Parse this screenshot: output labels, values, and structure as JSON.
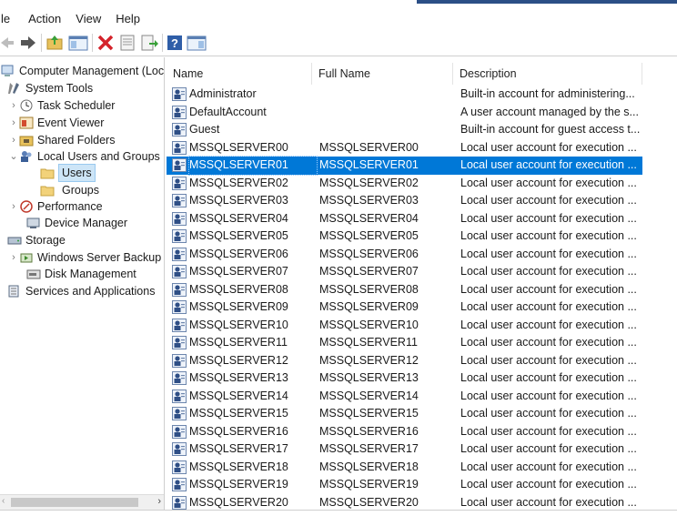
{
  "menu": {
    "items": [
      "le",
      "Action",
      "View",
      "Help"
    ]
  },
  "toolbar": {
    "buttons": [
      "back-arrow-icon",
      "forward-arrow-icon",
      "up-folder-icon",
      "show-hide-tree-icon",
      "delete-icon",
      "properties-icon",
      "export-list-icon",
      "help-icon",
      "action-pane-icon"
    ]
  },
  "tree": {
    "items": [
      {
        "label": "Computer Management (Local",
        "icon": "computer-management-icon"
      },
      {
        "label": "System Tools",
        "icon": "system-tools-icon"
      },
      {
        "label": "Task Scheduler",
        "icon": "task-scheduler-icon"
      },
      {
        "label": "Event Viewer",
        "icon": "event-viewer-icon"
      },
      {
        "label": "Shared Folders",
        "icon": "shared-folders-icon"
      },
      {
        "label": "Local Users and Groups",
        "icon": "local-users-icon"
      },
      {
        "label": "Users",
        "icon": "folder-icon"
      },
      {
        "label": "Groups",
        "icon": "folder-icon"
      },
      {
        "label": "Performance",
        "icon": "performance-icon"
      },
      {
        "label": "Device Manager",
        "icon": "device-manager-icon"
      },
      {
        "label": "Storage",
        "icon": "storage-icon"
      },
      {
        "label": "Windows Server Backup",
        "icon": "backup-icon"
      },
      {
        "label": "Disk Management",
        "icon": "disk-management-icon"
      },
      {
        "label": "Services and Applications",
        "icon": "services-icon"
      }
    ]
  },
  "table": {
    "columns": [
      "Name",
      "Full Name",
      "Description"
    ],
    "rows": [
      {
        "name": "Administrator",
        "full": "",
        "desc": "Built-in account for administering..."
      },
      {
        "name": "DefaultAccount",
        "full": "",
        "desc": "A user account managed by the s..."
      },
      {
        "name": "Guest",
        "full": "",
        "desc": "Built-in account for guest access t..."
      },
      {
        "name": "MSSQLSERVER00",
        "full": "MSSQLSERVER00",
        "desc": "Local user account for execution ..."
      },
      {
        "name": "MSSQLSERVER01",
        "full": "MSSQLSERVER01",
        "desc": "Local user account for execution ..."
      },
      {
        "name": "MSSQLSERVER02",
        "full": "MSSQLSERVER02",
        "desc": "Local user account for execution ..."
      },
      {
        "name": "MSSQLSERVER03",
        "full": "MSSQLSERVER03",
        "desc": "Local user account for execution ..."
      },
      {
        "name": "MSSQLSERVER04",
        "full": "MSSQLSERVER04",
        "desc": "Local user account for execution ..."
      },
      {
        "name": "MSSQLSERVER05",
        "full": "MSSQLSERVER05",
        "desc": "Local user account for execution ..."
      },
      {
        "name": "MSSQLSERVER06",
        "full": "MSSQLSERVER06",
        "desc": "Local user account for execution ..."
      },
      {
        "name": "MSSQLSERVER07",
        "full": "MSSQLSERVER07",
        "desc": "Local user account for execution ..."
      },
      {
        "name": "MSSQLSERVER08",
        "full": "MSSQLSERVER08",
        "desc": "Local user account for execution ..."
      },
      {
        "name": "MSSQLSERVER09",
        "full": "MSSQLSERVER09",
        "desc": "Local user account for execution ..."
      },
      {
        "name": "MSSQLSERVER10",
        "full": "MSSQLSERVER10",
        "desc": "Local user account for execution ..."
      },
      {
        "name": "MSSQLSERVER11",
        "full": "MSSQLSERVER11",
        "desc": "Local user account for execution ..."
      },
      {
        "name": "MSSQLSERVER12",
        "full": "MSSQLSERVER12",
        "desc": "Local user account for execution ..."
      },
      {
        "name": "MSSQLSERVER13",
        "full": "MSSQLSERVER13",
        "desc": "Local user account for execution ..."
      },
      {
        "name": "MSSQLSERVER14",
        "full": "MSSQLSERVER14",
        "desc": "Local user account for execution ..."
      },
      {
        "name": "MSSQLSERVER15",
        "full": "MSSQLSERVER15",
        "desc": "Local user account for execution ..."
      },
      {
        "name": "MSSQLSERVER16",
        "full": "MSSQLSERVER16",
        "desc": "Local user account for execution ..."
      },
      {
        "name": "MSSQLSERVER17",
        "full": "MSSQLSERVER17",
        "desc": "Local user account for execution ..."
      },
      {
        "name": "MSSQLSERVER18",
        "full": "MSSQLSERVER18",
        "desc": "Local user account for execution ..."
      },
      {
        "name": "MSSQLSERVER19",
        "full": "MSSQLSERVER19",
        "desc": "Local user account for execution ..."
      },
      {
        "name": "MSSQLSERVER20",
        "full": "MSSQLSERVER20",
        "desc": "Local user account for execution ..."
      }
    ],
    "selected_index": 4
  },
  "colors": {
    "selection": "#0078d7",
    "tree_selection": "#cde5f7",
    "title_accent": "#2b4f86"
  }
}
